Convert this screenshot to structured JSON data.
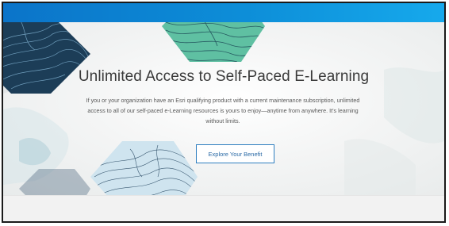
{
  "hero": {
    "title": "Unlimited Access to Self-Paced E-Learning",
    "description": "If you or your organization have an Esri qualifying product with a current maintenance subscription, unlimited access to all of our self-paced e-Learning resources is yours to enjoy—anytime from anywhere. It's learning without limits.",
    "cta_label": "Explore Your Benefit"
  },
  "colors": {
    "top_bar": "#0d8ed8",
    "button_border": "#2f7fc0",
    "button_text": "#2a6aa6",
    "title_text": "#3a3a3a"
  }
}
